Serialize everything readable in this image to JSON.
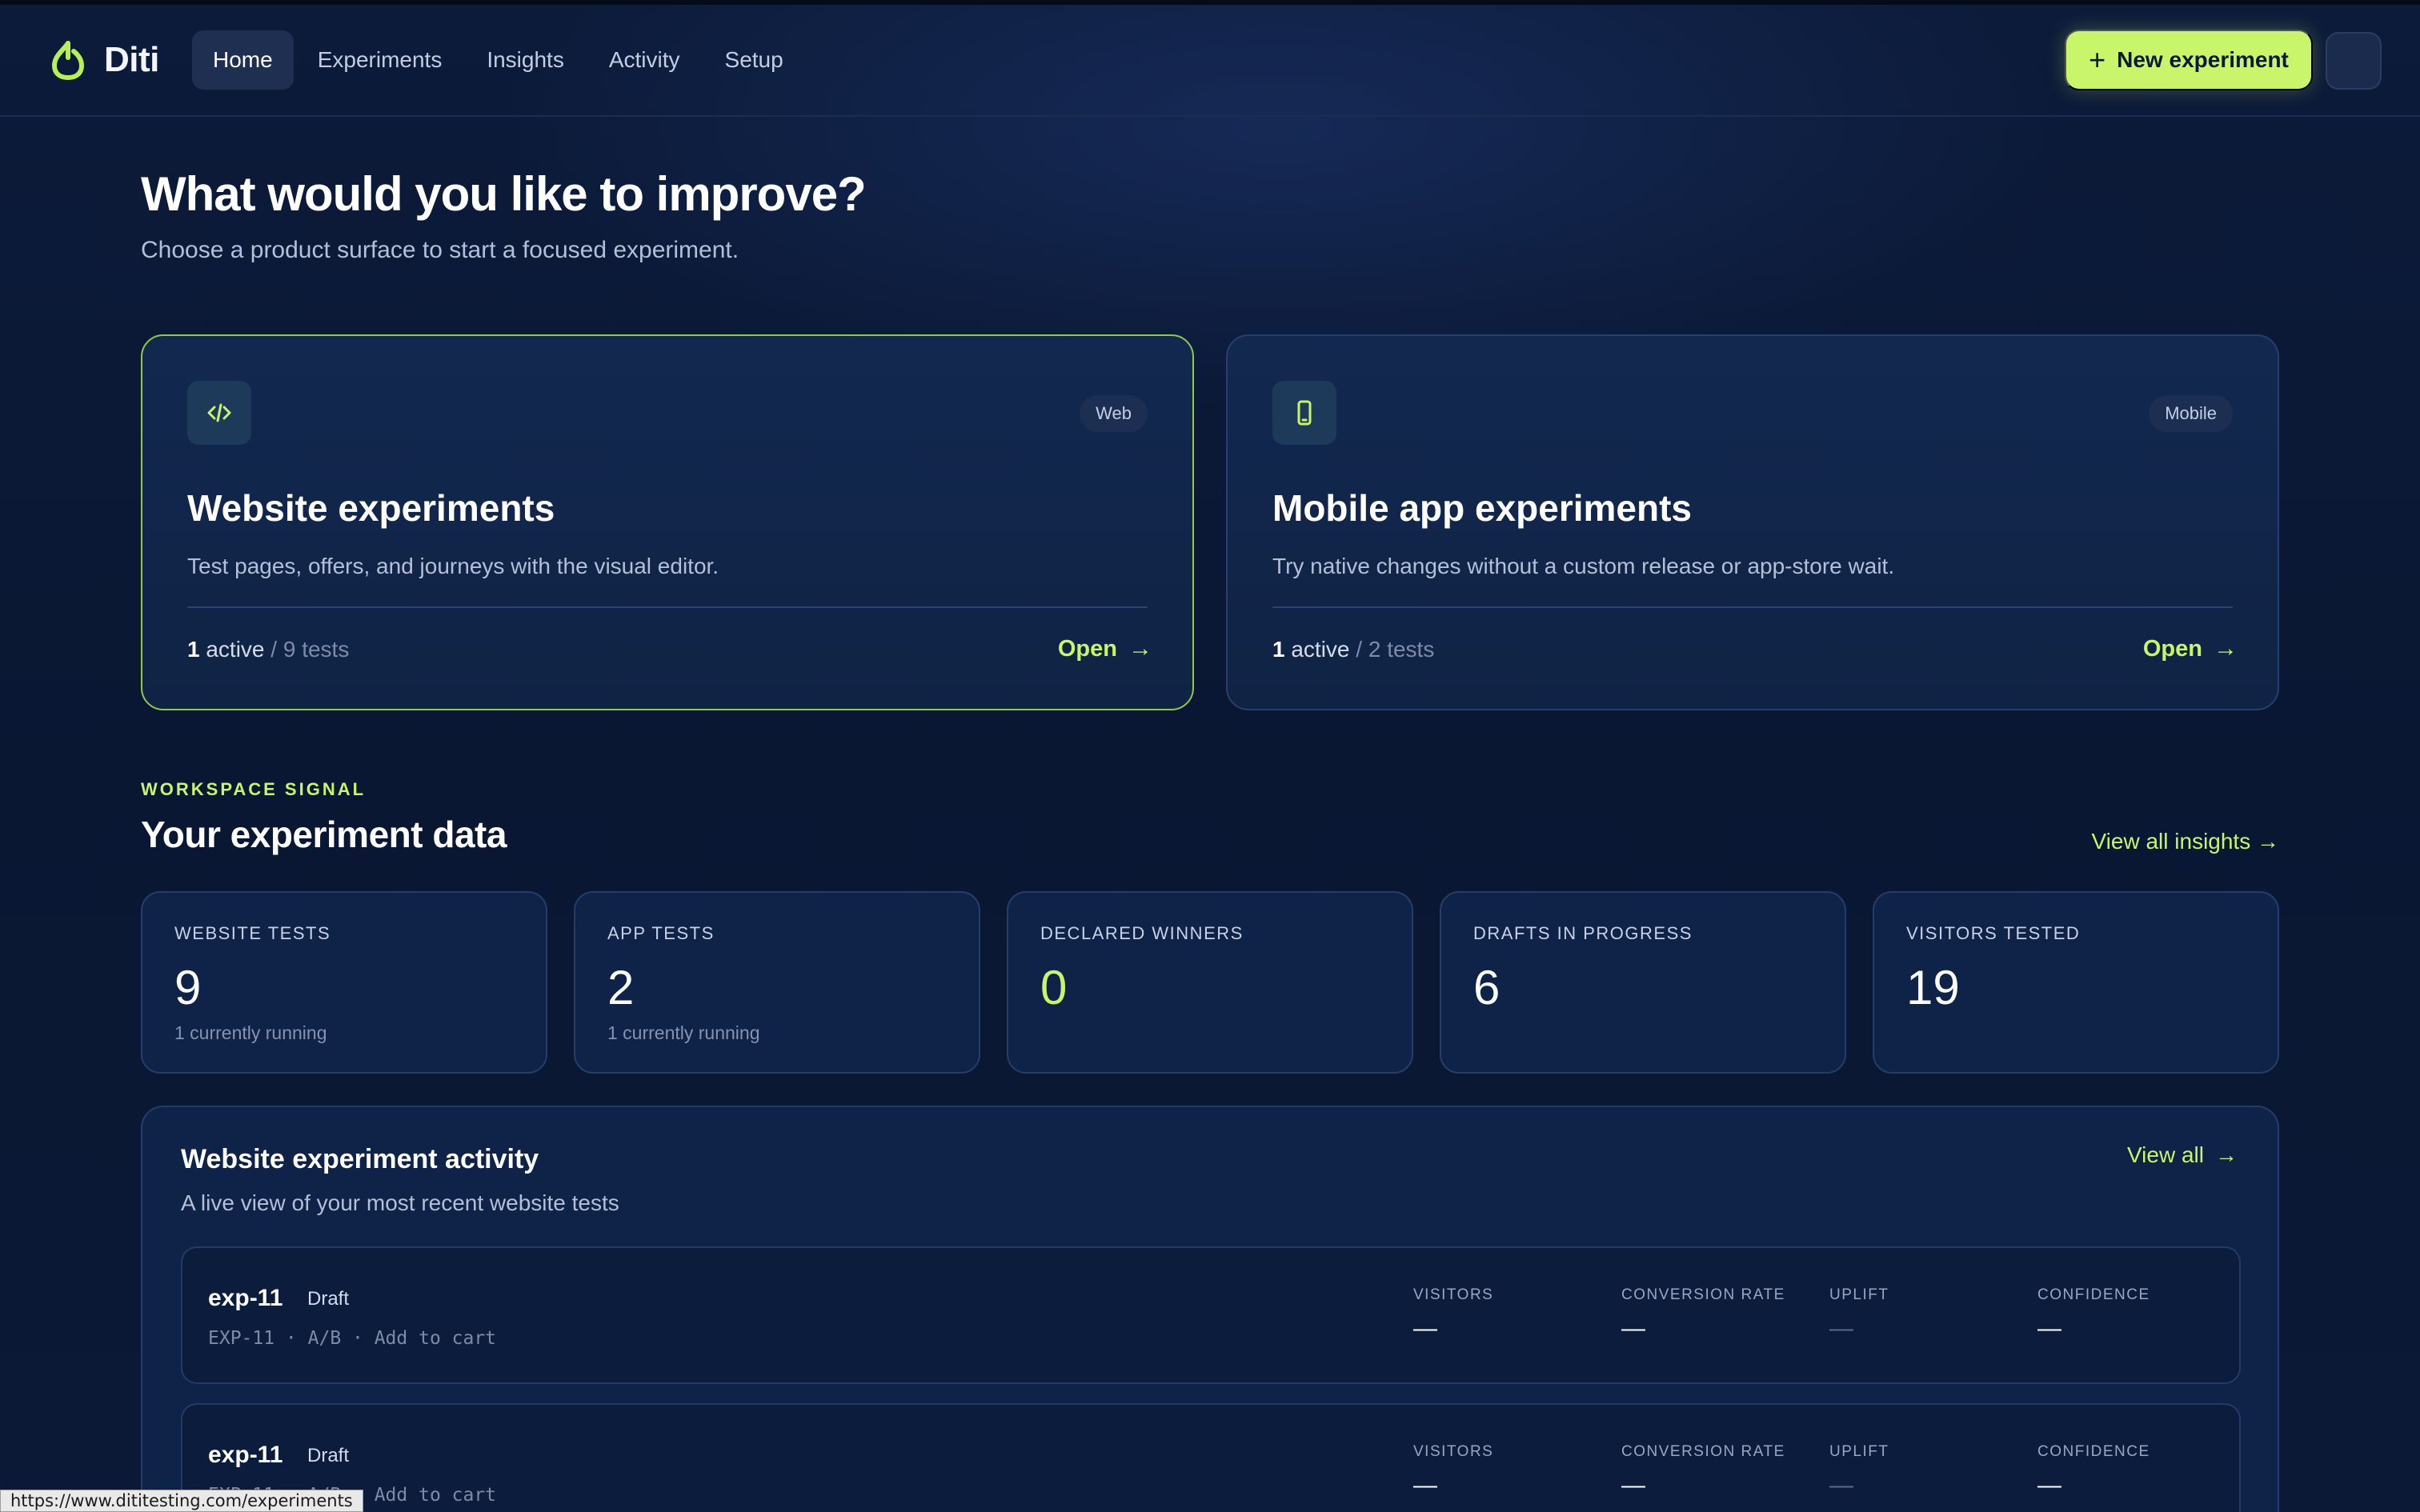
{
  "app": {
    "name": "Diti"
  },
  "nav": {
    "links": [
      "Home",
      "Experiments",
      "Insights",
      "Activity",
      "Setup"
    ],
    "active": "Home",
    "new_button": "New experiment"
  },
  "hero": {
    "title": "What would you like to improve?",
    "subtitle": "Choose a product surface to start a focused experiment."
  },
  "surfaces": [
    {
      "badge": "Web",
      "title": "Website experiments",
      "description": "Test pages, offers, and journeys with the visual editor.",
      "active_count": "1",
      "active_word": "active",
      "tests": "/ 9 tests",
      "open": "Open",
      "icon": "code-icon"
    },
    {
      "badge": "Mobile",
      "title": "Mobile app experiments",
      "description": "Try native changes without a custom release or app-store wait.",
      "active_count": "1",
      "active_word": "active",
      "tests": "/ 2 tests",
      "open": "Open",
      "icon": "phone-icon"
    }
  ],
  "signal": {
    "eyebrow": "WORKSPACE SIGNAL",
    "title": "Your experiment data",
    "view_all": "View all insights →"
  },
  "stats": [
    {
      "label": "WEBSITE TESTS",
      "value": "9",
      "sub": "1 currently running"
    },
    {
      "label": "APP TESTS",
      "value": "2",
      "sub": "1 currently running"
    },
    {
      "label": "DECLARED WINNERS",
      "value": "0",
      "sub": ""
    },
    {
      "label": "DRAFTS IN PROGRESS",
      "value": "6",
      "sub": ""
    },
    {
      "label": "VISITORS TESTED",
      "value": "19",
      "sub": ""
    }
  ],
  "activity": {
    "title": "Website experiment activity",
    "subtitle": "A live view of your most recent website tests",
    "view_all": "View all",
    "metric_labels": [
      "VISITORS",
      "CONVERSION RATE",
      "UPLIFT",
      "CONFIDENCE"
    ],
    "rows": [
      {
        "name": "exp-11",
        "status": "Draft",
        "meta": "EXP-11 · A/B · Add to cart",
        "values": [
          "—",
          "—",
          "—",
          "—"
        ]
      },
      {
        "name": "exp-11",
        "status": "Draft",
        "meta": "EXP-11 · A/B · Add to cart",
        "values": [
          "—",
          "—",
          "—",
          "—"
        ]
      }
    ]
  },
  "statusbar": {
    "url": "https://www.dititesting.com/experiments"
  },
  "colors": {
    "accent": "#c8f56a",
    "background": "#0b1a38",
    "card": "#12284f"
  }
}
